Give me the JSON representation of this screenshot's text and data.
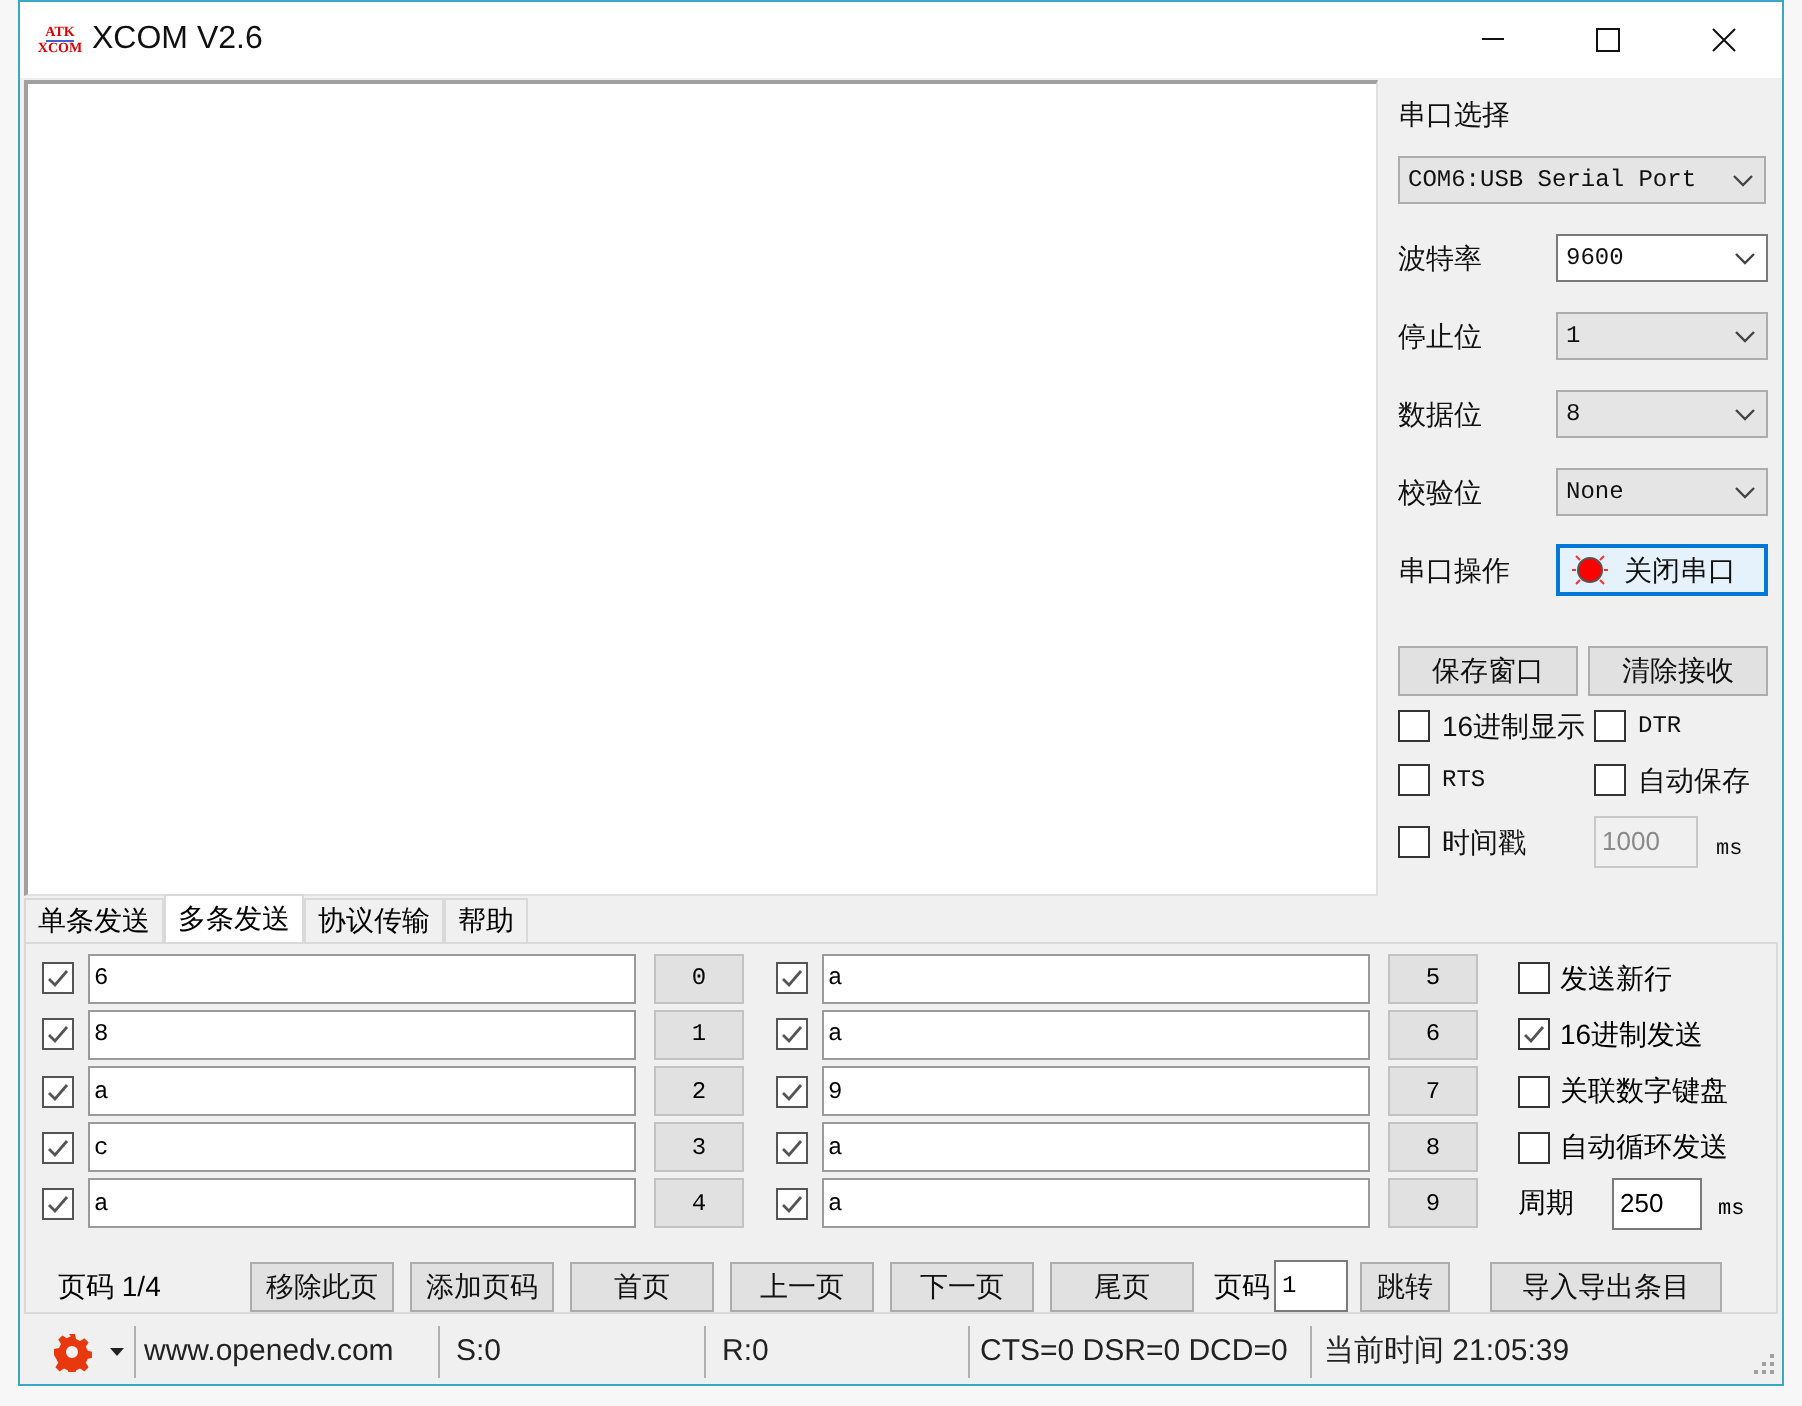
{
  "window": {
    "logo": {
      "top": "ATK",
      "bottom": "XCOM"
    },
    "title": "XCOM V2.6"
  },
  "serial": {
    "port_label": "串口选择",
    "port": "COM6:USB Serial Port",
    "fields": [
      {
        "label": "波特率",
        "value": "9600",
        "kind": "editable"
      },
      {
        "label": "停止位",
        "value": "1",
        "kind": "list"
      },
      {
        "label": "数据位",
        "value": "8",
        "kind": "list"
      },
      {
        "label": "校验位",
        "value": "None",
        "kind": "list"
      }
    ],
    "operation_label": "串口操作",
    "operation_button": {
      "label": "关闭串口",
      "port_open": true
    }
  },
  "receive_buttons": [
    "保存窗口",
    "清除接收"
  ],
  "receive_options": [
    {
      "label": "16进制显示",
      "checked": false
    },
    {
      "label": "DTR",
      "checked": false
    },
    {
      "label": "RTS",
      "checked": false
    },
    {
      "label": "自动保存",
      "checked": false
    },
    {
      "label": "时间戳",
      "checked": false
    }
  ],
  "timestamp": {
    "value": "1000",
    "unit": "ms",
    "disabled": true
  },
  "tabs": [
    {
      "label": "单条发送",
      "selected": false
    },
    {
      "label": "多条发送",
      "selected": true
    },
    {
      "label": "协议传输",
      "selected": false
    },
    {
      "label": "帮助",
      "selected": false
    }
  ],
  "send_items": [
    {
      "checked": true,
      "value": "6",
      "button": "0"
    },
    {
      "checked": true,
      "value": "8",
      "button": "1"
    },
    {
      "checked": true,
      "value": "a",
      "button": "2"
    },
    {
      "checked": true,
      "value": "c",
      "button": "3"
    },
    {
      "checked": true,
      "value": "a",
      "button": "4"
    },
    {
      "checked": true,
      "value": "a",
      "button": "5"
    },
    {
      "checked": true,
      "value": "a",
      "button": "6"
    },
    {
      "checked": true,
      "value": "9",
      "button": "7"
    },
    {
      "checked": true,
      "value": "a",
      "button": "8"
    },
    {
      "checked": true,
      "value": "a",
      "button": "9"
    }
  ],
  "send_options": [
    {
      "label": "发送新行",
      "checked": false
    },
    {
      "label": "16进制发送",
      "checked": true
    },
    {
      "label": "关联数字键盘",
      "checked": false
    },
    {
      "label": "自动循环发送",
      "checked": false
    }
  ],
  "period": {
    "label": "周期",
    "value": "250",
    "unit": "ms"
  },
  "pager": {
    "page_info": "页码 1/4",
    "buttons_left": [
      "移除此页",
      "添加页码",
      "首页",
      "上一页",
      "下一页",
      "尾页"
    ],
    "page_label": "页码",
    "page_value": "1",
    "jump": "跳转",
    "import_export": "导入导出条目"
  },
  "status_bar": {
    "website": "www.openedv.com",
    "sent": "S:0",
    "received": "R:0",
    "lines": "CTS=0 DSR=0 DCD=0",
    "time": "当前时间 21:05:39"
  }
}
